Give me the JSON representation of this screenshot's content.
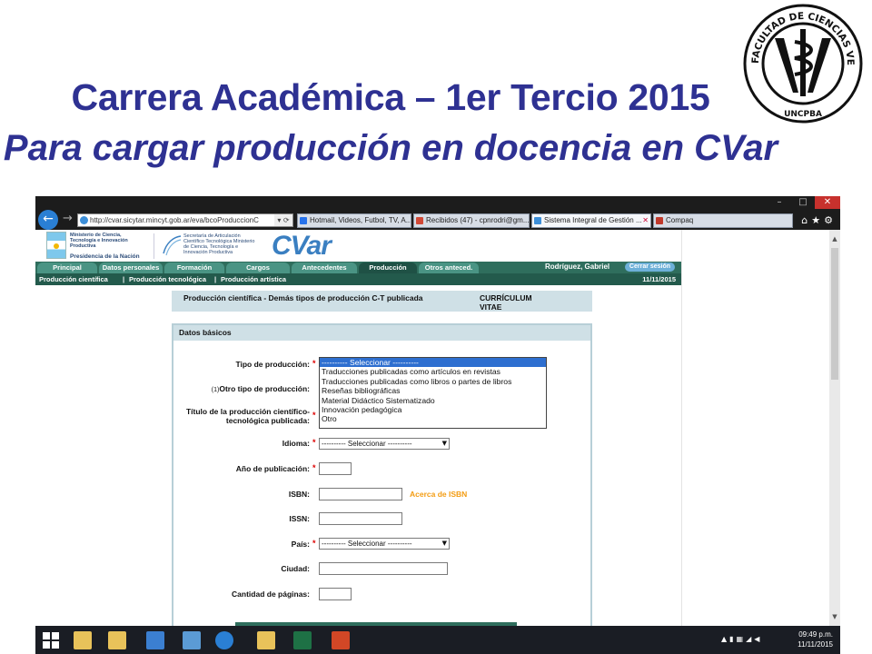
{
  "slide": {
    "title_line1": "Carrera Académica – 1er Tercio 2015",
    "title_line2": "Para cargar producción en docencia en CVar"
  },
  "logo": {
    "ring_text": "FACULTAD DE CIENCIAS VETERINARIAS",
    "bottom_text": "UNCPBA"
  },
  "browser": {
    "address": "http://cvar.sicytar.mincyt.gob.ar/eva/bcoProduccionC",
    "tabs": [
      {
        "label": "Hotmail, Videos, Futbol, TV, A...",
        "icon_color": "#2672ec"
      },
      {
        "label": "Recibidos (47) - cpnrodri@gm...",
        "icon_color": "#d14836"
      },
      {
        "label": "Sistema Integral de Gestión ...",
        "icon_color": "#3d8fd9"
      },
      {
        "label": "Compaq",
        "icon_color": "#c0392b"
      }
    ],
    "window_controls": [
      "–",
      "□",
      "✕"
    ]
  },
  "site": {
    "ministry1": "Ministerio de Ciencia, Tecnología e Innovación Productiva",
    "presidency": "Presidencia de la Nación",
    "ministry2": "Secretaría de Articulación Científico Tecnológica Ministerio de Ciencia, Tecnología e Innovación Productiva",
    "logo_text": "CVar",
    "nav_tabs": [
      "Principal",
      "Datos personales",
      "Formación",
      "Cargos",
      "Antecedentes",
      "Producción",
      "Otros anteced."
    ],
    "active_tab": "Producción",
    "user_name": "Rodríguez, Gabriel",
    "logout_label": "Cerrar sesión",
    "subnav": [
      "Producción científica",
      "Producción tecnológica",
      "Producción artística"
    ],
    "date": "11/11/2015"
  },
  "form": {
    "title": "Producción científica - Demás tipos de producción C-T publicada",
    "title_right": "CURRÍCULUM VITAE",
    "section": "Datos básicos",
    "labels": {
      "tipo": "Tipo de producción:",
      "otro_prefix": "(1)",
      "otro": "Otro tipo de producción:",
      "titulo": "Título de la producción científico-tecnológica publicada:",
      "idioma": "Idioma:",
      "anio": "Año de publicación:",
      "isbn": "ISBN:",
      "issn": "ISSN:",
      "pais": "País:",
      "ciudad": "Ciudad:",
      "paginas": "Cantidad de páginas:"
    },
    "required_mark": "*",
    "select_placeholder": "---------- Seleccionar ----------",
    "isbn_link": "Acerca de ISBN",
    "tipo_options": [
      "---------- Seleccionar ----------",
      "Traducciones publicadas como artículos en revistas",
      "Traducciones publicadas como libros o partes de libros",
      "Reseñas bibliográficas",
      "Material Didáctico Sistematizado",
      "Innovación pedagógica",
      "Otro"
    ],
    "tipo_selected_index": 0
  },
  "taskbar": {
    "icons": [
      {
        "name": "file-explorer-icon",
        "color": "#e8c25a"
      },
      {
        "name": "documents-icon",
        "color": "#e8c25a"
      },
      {
        "name": "network-icon",
        "color": "#3b7fd1"
      },
      {
        "name": "remote-icon",
        "color": "#5b9bd5"
      },
      {
        "name": "ie-icon",
        "color": "#2a7fd4"
      },
      {
        "name": "folder-icon",
        "color": "#e8c25a"
      },
      {
        "name": "excel-icon",
        "color": "#1e7145"
      },
      {
        "name": "powerpoint-icon",
        "color": "#d24726"
      }
    ],
    "time": "09:49 p.m.",
    "date": "11/11/2015"
  },
  "colors": {
    "title": "#2e3192",
    "nav_green": "#2f6e5d",
    "form_header": "#cfe0e6",
    "isbn_link": "#f39c12",
    "required": "#dd0000"
  }
}
